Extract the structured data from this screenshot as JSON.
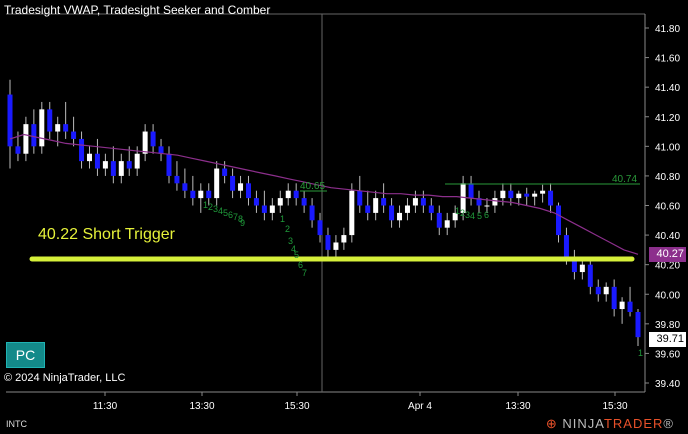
{
  "title": "Tradesight VWAP, Tradesight Seeker and Comber",
  "symbol": "INTC",
  "copyright": "© 2024 NinjaTrader, LLC",
  "pc_label": "PC",
  "annotation": "40.22 Short Trigger",
  "logo": {
    "ninja": "NINJA",
    "trader": "TRADER",
    "reg": "®"
  },
  "badges": {
    "vwap": "40.27",
    "last": "39.71"
  },
  "y_axis_labels": [
    "41.80",
    "41.60",
    "41.40",
    "41.20",
    "41.00",
    "40.80",
    "40.60",
    "40.40",
    "40.20",
    "40.00",
    "39.80",
    "39.60",
    "39.40"
  ],
  "x_axis_labels": [
    "11:30",
    "13:30",
    "15:30",
    "Apr 4",
    "13:30",
    "15:30"
  ],
  "levels": [
    {
      "text": "40.65"
    },
    {
      "text": "40.74"
    }
  ],
  "seeker_counts": [
    {
      "text": "1"
    },
    {
      "text": "2"
    },
    {
      "text": "3"
    },
    {
      "text": "4"
    },
    {
      "text": "5"
    },
    {
      "text": "6"
    },
    {
      "text": "7"
    },
    {
      "text": "8"
    },
    {
      "text": "9"
    },
    {
      "text": "1"
    },
    {
      "text": "2"
    },
    {
      "text": "3"
    },
    {
      "text": "4"
    },
    {
      "text": "5"
    },
    {
      "text": "6"
    },
    {
      "text": "7"
    },
    {
      "text": "1"
    },
    {
      "text": "2"
    },
    {
      "text": "3"
    },
    {
      "text": "4"
    },
    {
      "text": "5"
    },
    {
      "text": "6"
    },
    {
      "text": "1"
    }
  ],
  "colors": {
    "up": "#ffffff",
    "down": "#1a1aff",
    "vwap": "#8c2f8c",
    "trigger": "#d6f03a",
    "count": "#1f9a3a",
    "level": "#2a9a3a"
  },
  "chart_data": {
    "type": "candlestick",
    "ylim": [
      39.35,
      41.9
    ],
    "candles": [
      [
        41.35,
        41.45,
        40.85,
        41.0
      ],
      [
        41.0,
        41.1,
        40.9,
        40.95
      ],
      [
        40.95,
        41.2,
        40.9,
        41.15
      ],
      [
        41.15,
        41.25,
        40.95,
        41.0
      ],
      [
        41.0,
        41.3,
        40.95,
        41.25
      ],
      [
        41.25,
        41.3,
        41.05,
        41.1
      ],
      [
        41.1,
        41.2,
        41.0,
        41.15
      ],
      [
        41.15,
        41.3,
        41.05,
        41.1
      ],
      [
        41.1,
        41.2,
        41.0,
        41.05
      ],
      [
        41.05,
        41.1,
        40.85,
        40.9
      ],
      [
        40.9,
        41.0,
        40.85,
        40.95
      ],
      [
        40.95,
        41.05,
        40.8,
        40.85
      ],
      [
        40.85,
        40.95,
        40.8,
        40.9
      ],
      [
        40.9,
        41.0,
        40.75,
        40.8
      ],
      [
        40.8,
        40.95,
        40.75,
        40.9
      ],
      [
        40.9,
        41.0,
        40.8,
        40.85
      ],
      [
        40.85,
        41.0,
        40.8,
        40.95
      ],
      [
        40.95,
        41.15,
        40.9,
        41.1
      ],
      [
        41.1,
        41.15,
        40.95,
        41.0
      ],
      [
        41.0,
        41.05,
        40.9,
        40.95
      ],
      [
        40.95,
        41.0,
        40.75,
        40.8
      ],
      [
        40.8,
        40.9,
        40.7,
        40.75
      ],
      [
        40.75,
        40.85,
        40.65,
        40.7
      ],
      [
        40.7,
        40.8,
        40.6,
        40.65
      ],
      [
        40.65,
        40.75,
        40.55,
        40.7
      ],
      [
        40.7,
        40.75,
        40.6,
        40.65
      ],
      [
        40.65,
        40.9,
        40.6,
        40.85
      ],
      [
        40.85,
        40.9,
        40.75,
        40.8
      ],
      [
        40.8,
        40.85,
        40.65,
        40.7
      ],
      [
        40.7,
        40.8,
        40.65,
        40.75
      ],
      [
        40.75,
        40.8,
        40.6,
        40.65
      ],
      [
        40.65,
        40.7,
        40.55,
        40.6
      ],
      [
        40.6,
        40.7,
        40.5,
        40.55
      ],
      [
        40.55,
        40.65,
        40.5,
        40.6
      ],
      [
        40.6,
        40.7,
        40.55,
        40.65
      ],
      [
        40.65,
        40.75,
        40.6,
        40.7
      ],
      [
        40.7,
        40.75,
        40.6,
        40.65
      ],
      [
        40.65,
        40.7,
        40.55,
        40.6
      ],
      [
        40.6,
        40.65,
        40.45,
        40.5
      ],
      [
        40.5,
        40.55,
        40.35,
        40.4
      ],
      [
        40.4,
        40.45,
        40.25,
        40.3
      ],
      [
        40.3,
        40.4,
        40.25,
        40.35
      ],
      [
        40.35,
        40.45,
        40.3,
        40.4
      ],
      [
        40.4,
        40.75,
        40.35,
        40.7
      ],
      [
        40.7,
        40.8,
        40.55,
        40.6
      ],
      [
        40.6,
        40.7,
        40.5,
        40.55
      ],
      [
        40.55,
        40.7,
        40.5,
        40.65
      ],
      [
        40.65,
        40.75,
        40.55,
        40.6
      ],
      [
        40.6,
        40.65,
        40.45,
        40.5
      ],
      [
        40.5,
        40.6,
        40.45,
        40.55
      ],
      [
        40.55,
        40.65,
        40.5,
        40.6
      ],
      [
        40.6,
        40.7,
        40.55,
        40.65
      ],
      [
        40.65,
        40.7,
        40.55,
        40.6
      ],
      [
        40.6,
        40.65,
        40.5,
        40.55
      ],
      [
        40.55,
        40.6,
        40.4,
        40.45
      ],
      [
        40.45,
        40.55,
        40.4,
        40.5
      ],
      [
        40.5,
        40.6,
        40.45,
        40.55
      ],
      [
        40.55,
        40.8,
        40.5,
        40.75
      ],
      [
        40.75,
        40.8,
        40.6,
        40.65
      ],
      [
        40.65,
        40.7,
        40.55,
        40.6
      ],
      [
        40.6,
        40.65,
        40.55,
        40.6
      ],
      [
        40.6,
        40.7,
        40.55,
        40.65
      ],
      [
        40.65,
        40.75,
        40.6,
        40.7
      ],
      [
        40.7,
        40.75,
        40.6,
        40.65
      ],
      [
        40.65,
        40.7,
        40.6,
        40.68
      ],
      [
        40.68,
        40.72,
        40.6,
        40.66
      ],
      [
        40.66,
        40.7,
        40.6,
        40.68
      ],
      [
        40.68,
        40.74,
        40.62,
        40.7
      ],
      [
        40.7,
        40.75,
        40.55,
        40.6
      ],
      [
        40.6,
        40.62,
        40.35,
        40.4
      ],
      [
        40.4,
        40.45,
        40.2,
        40.25
      ],
      [
        40.25,
        40.3,
        40.1,
        40.15
      ],
      [
        40.15,
        40.25,
        40.1,
        40.2
      ],
      [
        40.2,
        40.25,
        40.0,
        40.05
      ],
      [
        40.05,
        40.1,
        39.95,
        40.0
      ],
      [
        40.0,
        40.08,
        39.95,
        40.05
      ],
      [
        40.05,
        40.1,
        39.85,
        39.9
      ],
      [
        39.9,
        39.98,
        39.8,
        39.95
      ],
      [
        39.95,
        40.05,
        39.85,
        39.88
      ],
      [
        39.88,
        39.9,
        39.65,
        39.71
      ]
    ],
    "vwap": [
      41.05,
      41.08,
      41.06,
      41.04,
      41.02,
      41.01,
      41.0,
      40.99,
      40.98,
      40.97,
      40.96,
      40.95,
      40.94,
      40.92,
      40.9,
      40.88,
      40.86,
      40.84,
      40.82,
      40.8,
      40.78,
      40.76,
      40.74,
      40.72,
      40.71,
      40.7,
      40.69,
      40.68,
      40.68,
      40.67,
      40.67,
      40.66,
      40.66,
      40.65,
      40.64,
      40.63,
      40.62,
      40.6,
      40.58,
      40.55,
      40.5,
      40.45,
      40.4,
      40.35,
      40.3,
      40.27
    ]
  }
}
